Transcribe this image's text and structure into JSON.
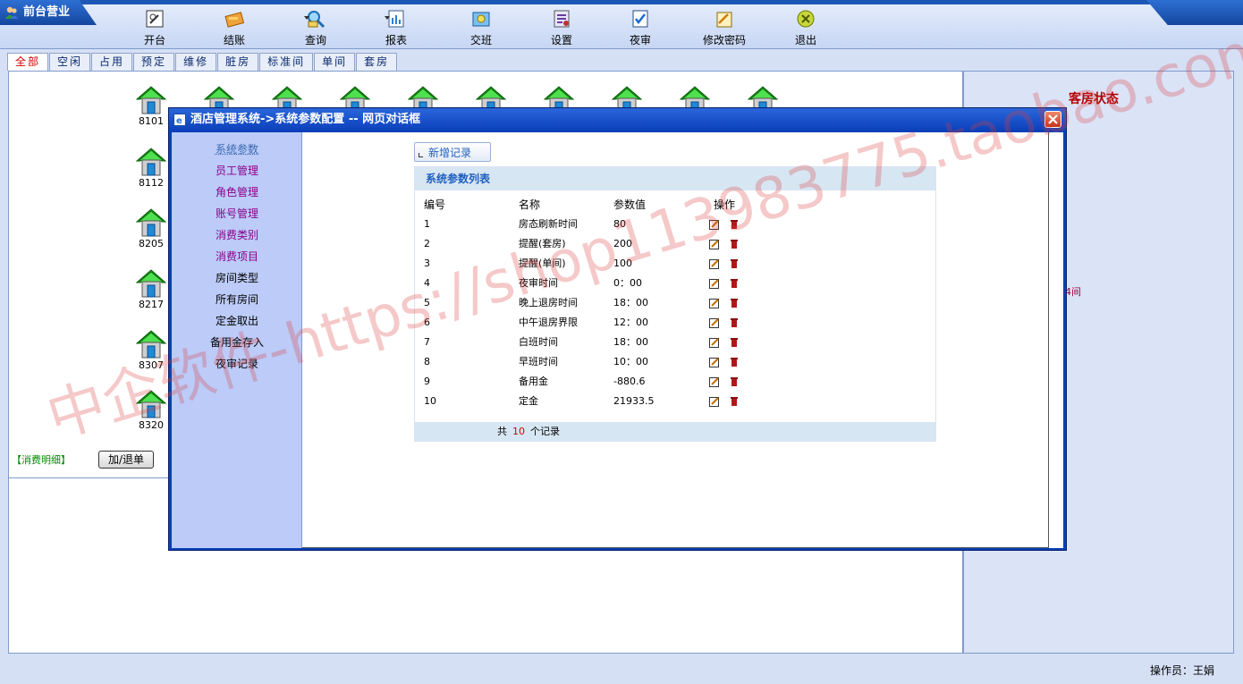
{
  "app": {
    "title": "前台营业"
  },
  "toolbar": {
    "items": [
      {
        "label": "开台",
        "icon": "open-table-icon"
      },
      {
        "label": "结账",
        "icon": "checkout-icon"
      },
      {
        "label": "查询",
        "icon": "query-icon"
      },
      {
        "label": "报表",
        "icon": "report-icon"
      },
      {
        "label": "交班",
        "icon": "shift-icon"
      },
      {
        "label": "设置",
        "icon": "settings-icon"
      },
      {
        "label": "夜审",
        "icon": "night-audit-icon"
      },
      {
        "label": "修改密码",
        "icon": "change-password-icon"
      },
      {
        "label": "退出",
        "icon": "exit-icon"
      }
    ]
  },
  "filter_tabs": [
    "全部",
    "空闲",
    "占用",
    "预定",
    "维修",
    "脏房",
    "标准间",
    "单间",
    "套房"
  ],
  "rooms": [
    "8101",
    "8112",
    "8205",
    "8217",
    "8307",
    "8320"
  ],
  "right_panel": {
    "title": "客房状态",
    "fragment": "4间"
  },
  "consume": {
    "label": "【消费明细】",
    "button": "加/退单"
  },
  "status_bar": {
    "operator": "操作员：王娟"
  },
  "dialog": {
    "title": "酒店管理系统->系统参数配置  --  网页对话框",
    "menu": [
      {
        "label": "系统参数",
        "style": "sel"
      },
      {
        "label": "员工管理",
        "style": "v"
      },
      {
        "label": "角色管理",
        "style": "v"
      },
      {
        "label": "账号管理",
        "style": "v"
      },
      {
        "label": "消费类别",
        "style": "v"
      },
      {
        "label": "消费项目",
        "style": "v"
      },
      {
        "label": "房间类型",
        "style": "d"
      },
      {
        "label": "所有房间",
        "style": "d"
      },
      {
        "label": "定金取出",
        "style": "d"
      },
      {
        "label": "备用金存入",
        "style": "d"
      },
      {
        "label": "夜审记录",
        "style": "d"
      }
    ],
    "add_button": "新增记录",
    "list_title": "系统参数列表",
    "columns": [
      "编号",
      "名称",
      "参数值",
      "操作"
    ],
    "rows": [
      {
        "id": "1",
        "name": "房态刷新时间",
        "value": "80"
      },
      {
        "id": "2",
        "name": "提醒(套房)",
        "value": "200"
      },
      {
        "id": "3",
        "name": "提醒(单间)",
        "value": "100"
      },
      {
        "id": "4",
        "name": "夜审时间",
        "value": "0：00"
      },
      {
        "id": "5",
        "name": "晚上退房时间",
        "value": "18：00"
      },
      {
        "id": "6",
        "name": "中午退房界限",
        "value": "12：00"
      },
      {
        "id": "7",
        "name": "白班时间",
        "value": "18：00"
      },
      {
        "id": "8",
        "name": "早班时间",
        "value": "10：00"
      },
      {
        "id": "9",
        "name": "备用金",
        "value": "-880.6"
      },
      {
        "id": "10",
        "name": "定金",
        "value": "21933.5"
      }
    ],
    "footer": {
      "prefix": "共",
      "count": "10",
      "suffix": "个记录"
    }
  },
  "watermark": "中企软件-https://shop113983775.taobao.com"
}
